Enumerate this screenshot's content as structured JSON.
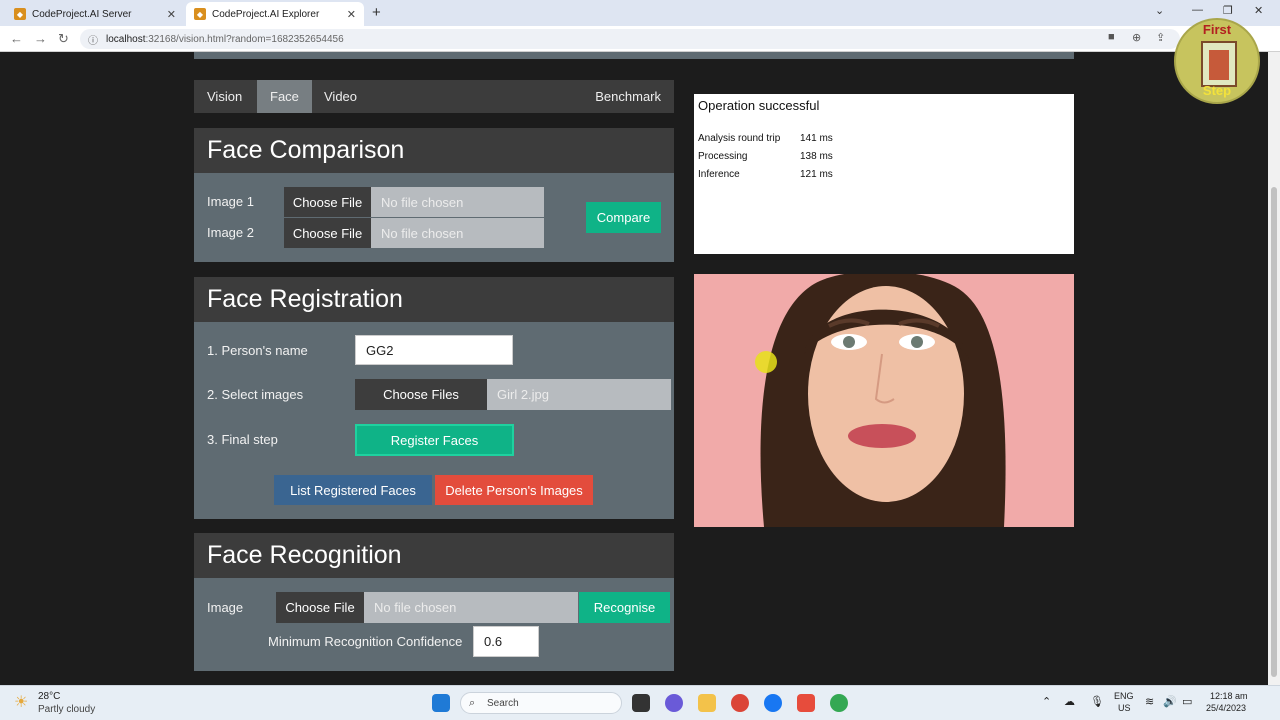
{
  "browser": {
    "tabs": [
      {
        "title": "CodeProject.AI Server"
      },
      {
        "title": "CodeProject.AI Explorer"
      }
    ],
    "url_host": "localhost",
    "url_rest": ":32168/vision.html?random=1682352654456"
  },
  "nav_tabs": [
    "Vision",
    "Face",
    "Video",
    "Benchmark"
  ],
  "face_comparison": {
    "title": "Face Comparison",
    "image1_label": "Image 1",
    "image2_label": "Image 2",
    "choose_file": "Choose File",
    "no_file": "No file chosen",
    "compare_button": "Compare"
  },
  "face_registration": {
    "title": "Face Registration",
    "name_label": "1. Person's name",
    "name_value": "GG2",
    "select_label": "2. Select images",
    "choose_files": "Choose Files",
    "selected_file": "Girl 2.jpg",
    "final_label": "3. Final step",
    "register_button": "Register Faces",
    "list_button": "List Registered Faces",
    "delete_button": "Delete Person's Images"
  },
  "face_recognition": {
    "title": "Face Recognition",
    "image_label": "Image",
    "choose_file": "Choose File",
    "no_file": "No file chosen",
    "recognise_button": "Recognise",
    "confidence_label": "Minimum Recognition Confidence",
    "confidence_value": "0.6"
  },
  "result": {
    "status": "Operation successful",
    "rows": [
      {
        "k": "Analysis round trip",
        "v": "141 ms"
      },
      {
        "k": "Processing",
        "v": "138 ms"
      },
      {
        "k": "Inference",
        "v": "121 ms"
      }
    ]
  },
  "badge": {
    "top": "First",
    "bottom": "Step"
  },
  "taskbar": {
    "temp": "28°C",
    "weather": "Partly cloudy",
    "search": "Search",
    "lang1": "ENG",
    "lang2": "US",
    "time": "12:18 am",
    "date": "25/4/2023"
  },
  "colors": {
    "panel": "#5f6b72",
    "header": "#3c3c3c",
    "green": "#0fb387",
    "blue": "#3a6591",
    "red": "#e34c3c"
  }
}
